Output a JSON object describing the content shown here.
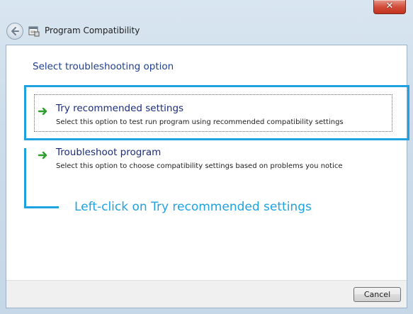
{
  "window": {
    "title": "Program Compatibility",
    "close_glyph": "✕"
  },
  "icons": {
    "back": "back-arrow-icon",
    "app": "program-compatibility-icon",
    "option_arrow": "green-arrow-icon"
  },
  "main": {
    "heading": "Select troubleshooting option",
    "options": [
      {
        "title": "Try recommended settings",
        "description": "Select this option to test run program using recommended compatibility settings"
      },
      {
        "title": "Troubleshoot program",
        "description": "Select this option to choose compatibility settings based on problems you notice"
      }
    ]
  },
  "annotation": {
    "text": "Left-click on Try recommended settings"
  },
  "footer": {
    "cancel_label": "Cancel"
  },
  "colors": {
    "heading": "#1f3f8f",
    "accent_callout": "#1ea2e0",
    "arrow_green": "#2e9e2e",
    "close_red": "#c2321f"
  }
}
